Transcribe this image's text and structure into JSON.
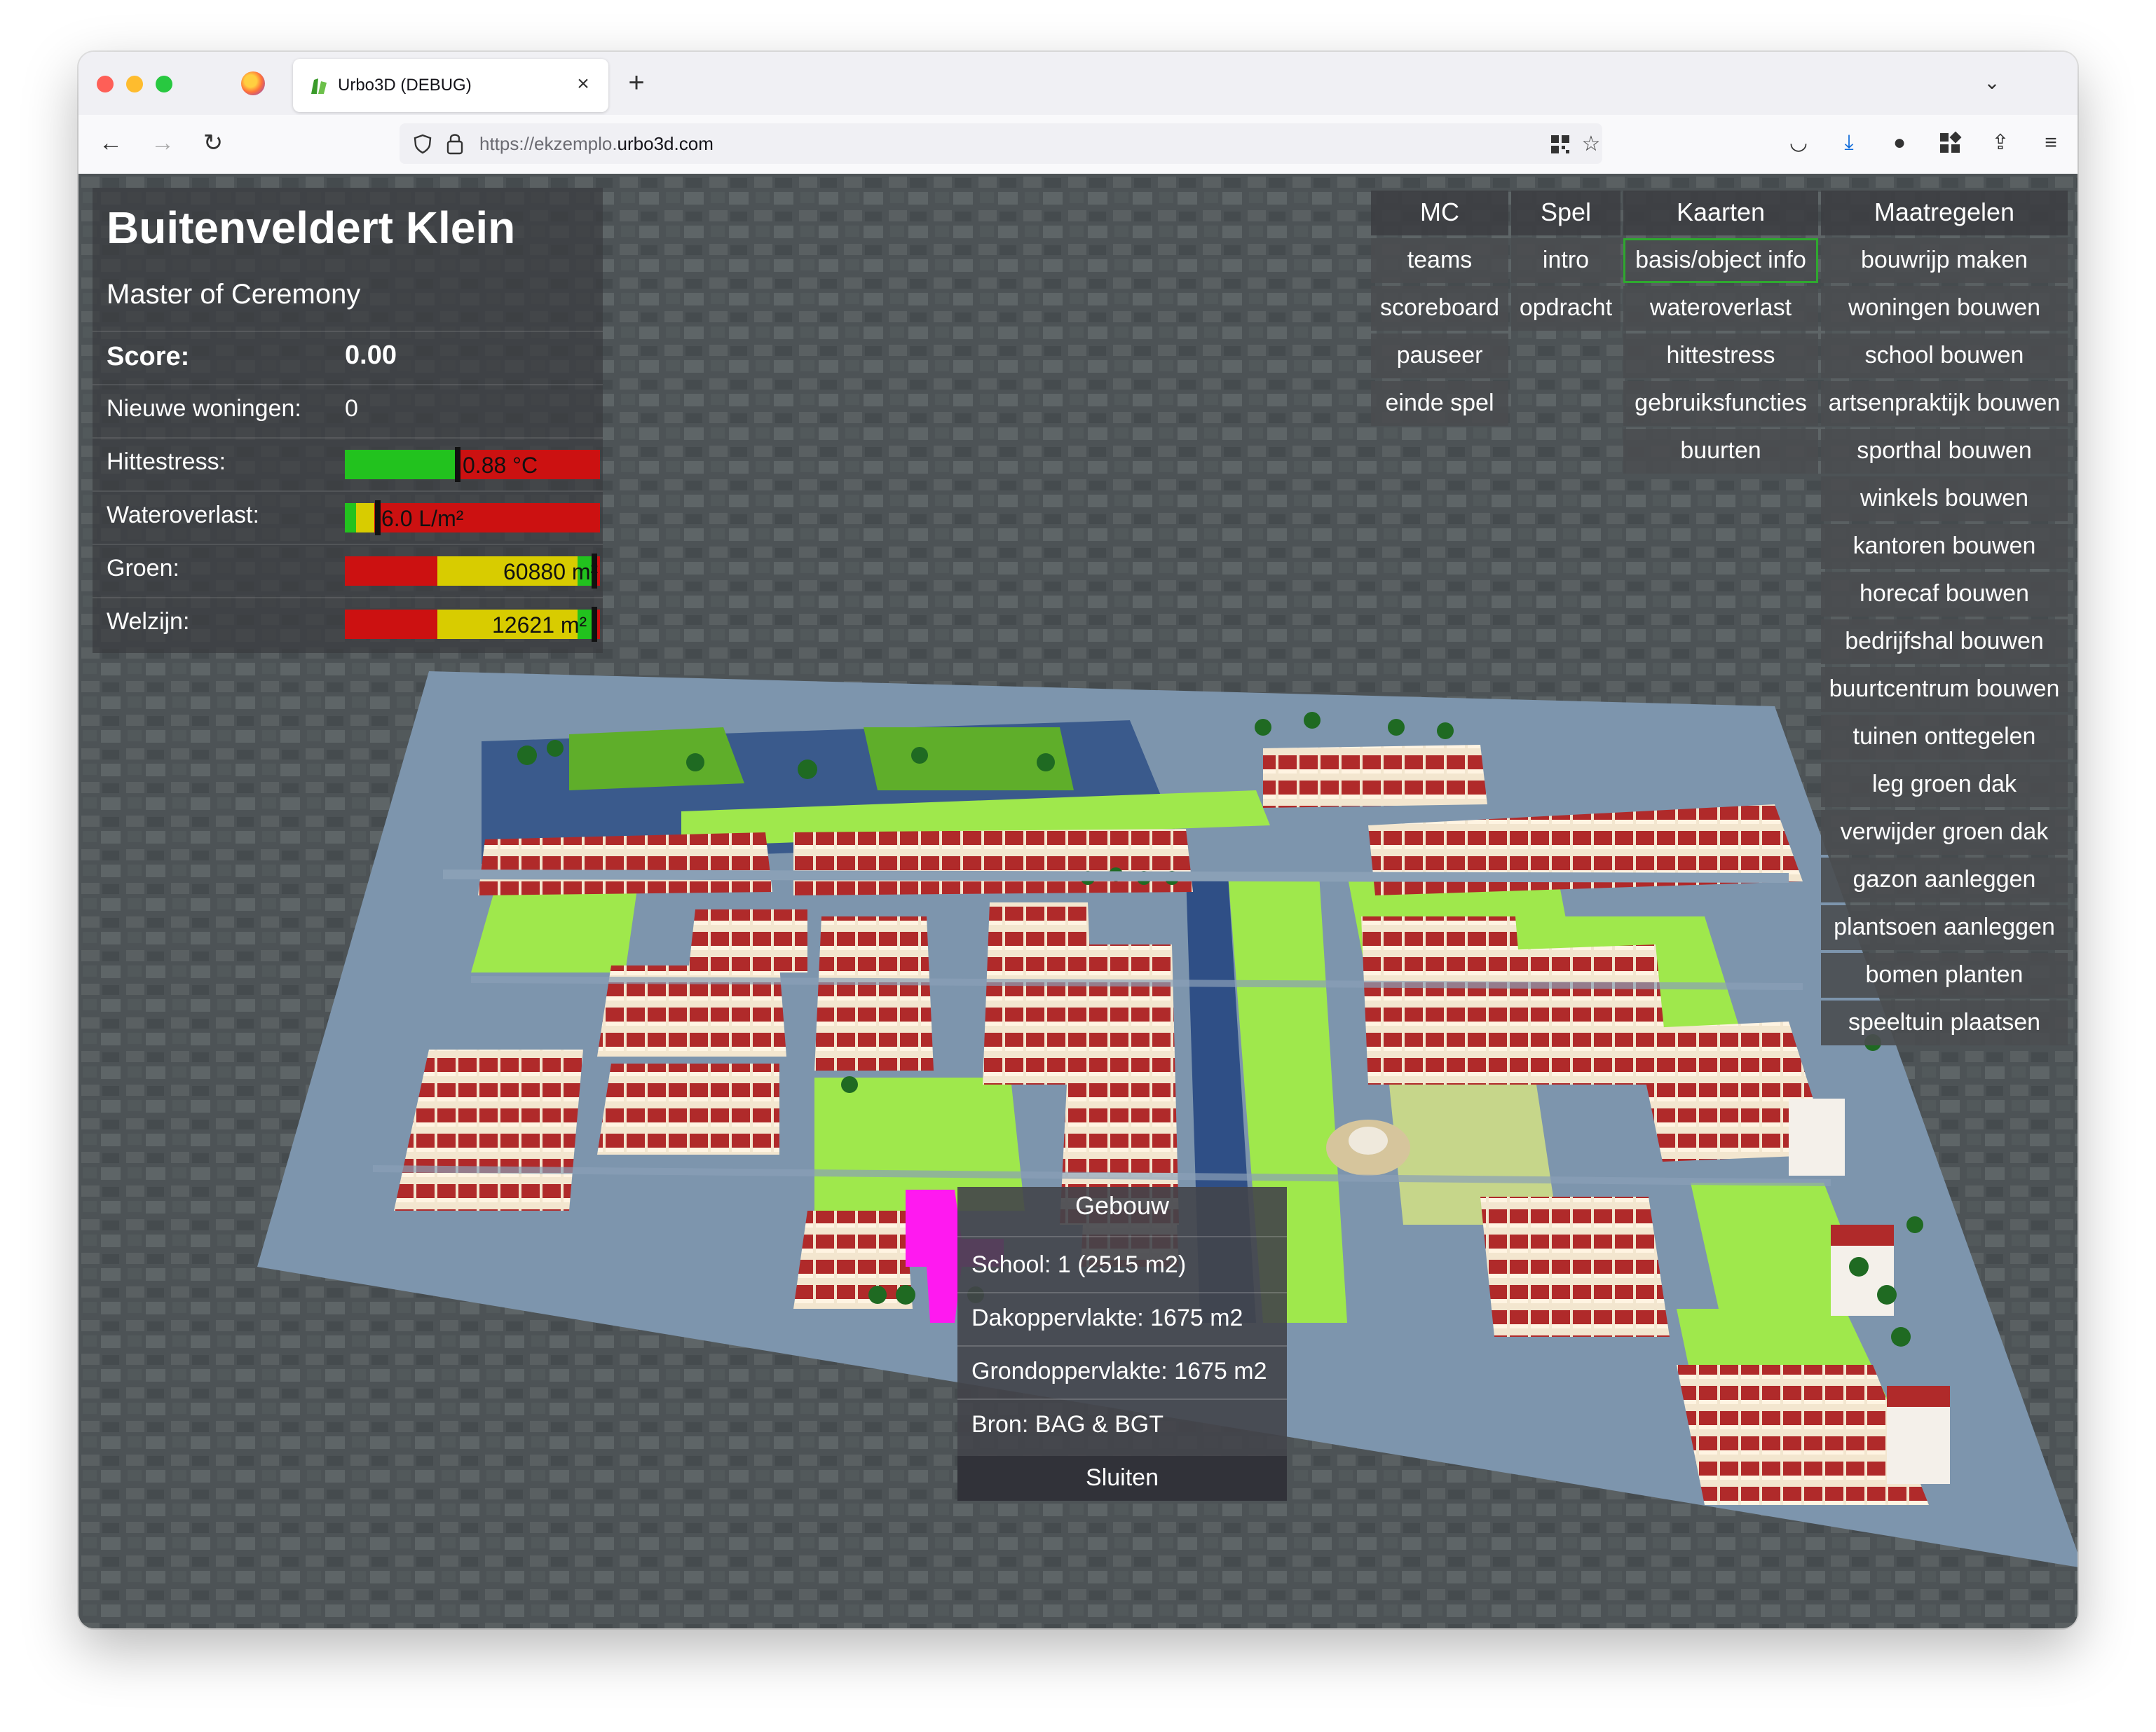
{
  "browser": {
    "tab_title": "Urbo3D (DEBUG)",
    "url_prefix": "https://ekzemplo.",
    "url_domain": "urbo3d.com"
  },
  "hud": {
    "title": "Buitenveldert Klein",
    "subtitle": "Master of Ceremony",
    "score_label": "Score:",
    "score_value": "0.00",
    "woningen_label": "Nieuwe woningen:",
    "woningen_value": "0",
    "hittestress": {
      "label": "Hittestress:",
      "value": "0.88 °C",
      "marker": 0.44
    },
    "wateroverlast": {
      "label": "Wateroverlast:",
      "value": "6.0 L/m²",
      "marker": 0.12
    },
    "groen": {
      "label": "Groen:",
      "value": "60880 m²",
      "marker": 0.99
    },
    "welzijn": {
      "label": "Welzijn:",
      "value": "12621 m²",
      "marker": 0.99
    },
    "colors": {
      "green": "#22c21e",
      "yellow": "#d8cc00",
      "red": "#cc1111"
    }
  },
  "menu": {
    "mc": {
      "header": "MC",
      "items": [
        "teams",
        "scoreboard",
        "pauseer",
        "einde spel"
      ]
    },
    "spel": {
      "header": "Spel",
      "items": [
        "intro",
        "opdracht"
      ]
    },
    "kaarten": {
      "header": "Kaarten",
      "items": [
        "basis/object info",
        "wateroverlast",
        "hittestress",
        "gebruiksfuncties",
        "buurten"
      ]
    },
    "maatregelen": {
      "header": "Maatregelen",
      "items": [
        "bouwrijp maken",
        "woningen bouwen",
        "school bouwen",
        "artsenpraktijk bouwen",
        "sporthal bouwen",
        "winkels bouwen",
        "kantoren bouwen",
        "horecaf bouwen",
        "bedrijfshal bouwen",
        "buurtcentrum bouwen",
        "tuinen onttegelen",
        "leg groen dak",
        "verwijder groen dak",
        "gazon aanleggen",
        "plantsoen aanleggen",
        "bomen planten",
        "speeltuin plaatsen"
      ]
    },
    "active_item": "basis/object info",
    "active_color": "#2fa82f"
  },
  "popup": {
    "title": "Gebouw",
    "rows": [
      "School: 1 (2515 m2)",
      "Dakoppervlakte: 1675 m2",
      "Grondoppervlakte: 1675 m2",
      "Bron: BAG & BGT"
    ],
    "close_label": "Sluiten"
  },
  "icons": [
    "firefox-icon",
    "urbo-favicon",
    "close-icon",
    "plus-icon",
    "chevron-down-icon",
    "back-icon",
    "forward-icon",
    "reload-icon",
    "shield-icon",
    "lock-icon",
    "qr-icon",
    "star-icon",
    "pocket-icon",
    "download-icon",
    "extensions-icon",
    "menu-icon"
  ]
}
